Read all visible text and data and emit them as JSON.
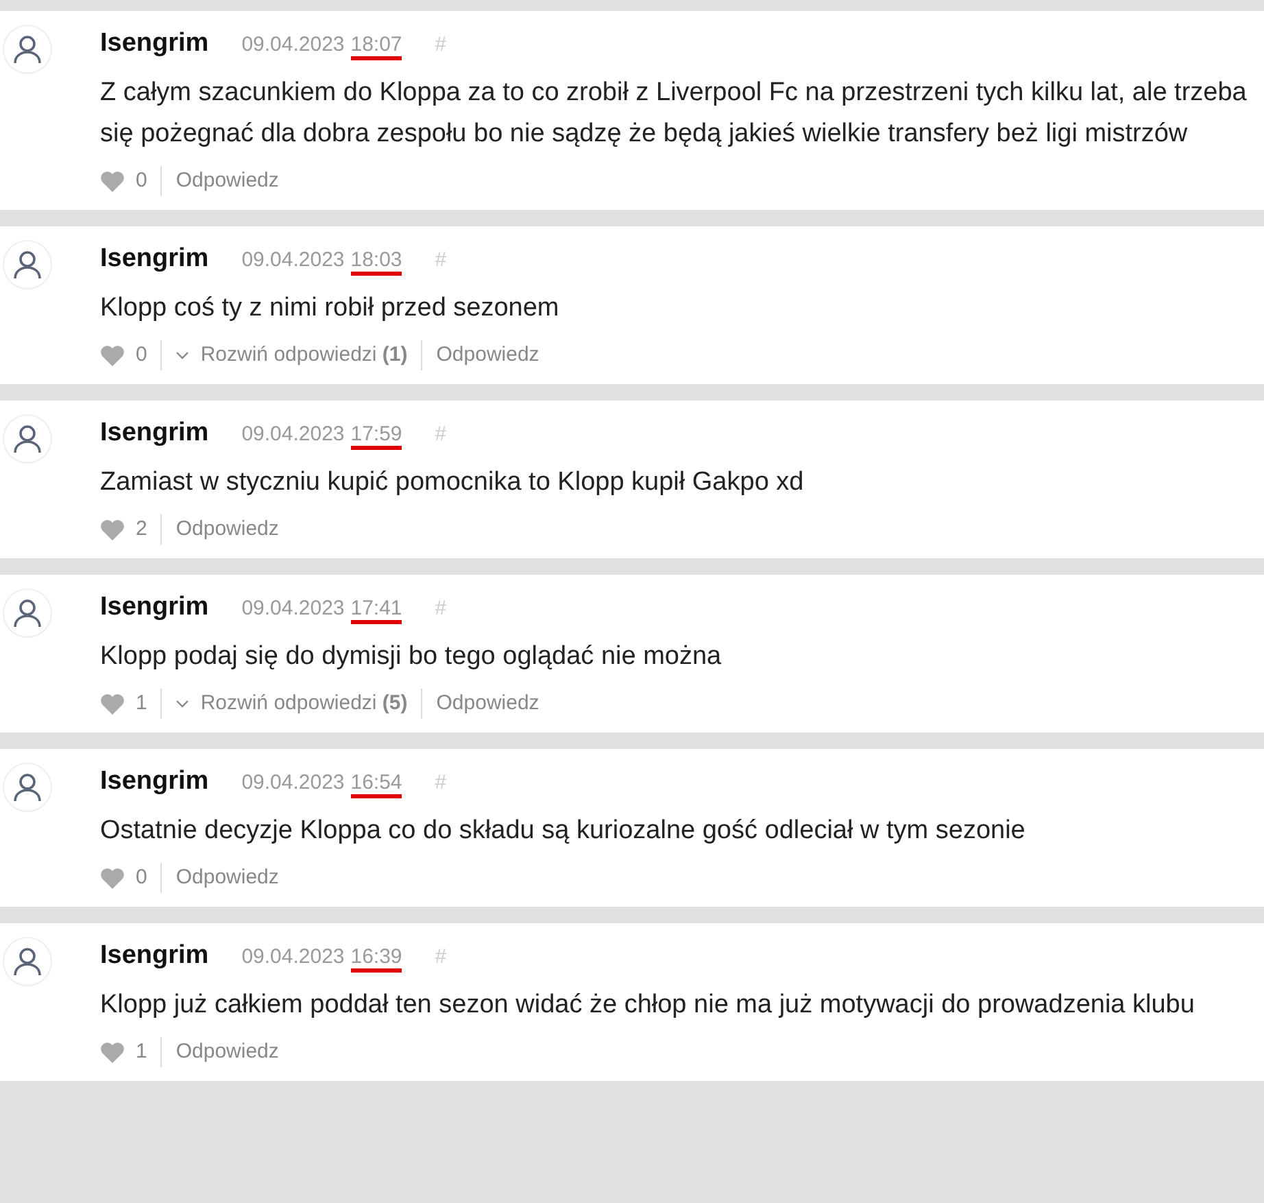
{
  "comments": [
    {
      "author": "Isengrim",
      "date": "09.04.2023",
      "time": "18:07",
      "time_marked": true,
      "hash": "#",
      "text": "Z całym szacunkiem do Kloppa za to co zrobił z Liverpool Fc na przestrzeni tych kilku lat, ale trzeba się pożegnać dla dobra zespołu bo nie sądzę że będą jakieś wielkie transfery beż ligi mistrzów",
      "likes": "0",
      "reply": "Odpowiedz"
    },
    {
      "author": "Isengrim",
      "date": "09.04.2023",
      "time": "18:03",
      "time_marked": true,
      "hash": "#",
      "text": "Klopp coś ty z nimi robił przed sezonem",
      "likes": "0",
      "expand": "Rozwiń odpowiedzi **(1)**",
      "reply": "Odpowiedz"
    },
    {
      "author": "Isengrim",
      "date": "09.04.2023",
      "time": "17:59",
      "time_marked": true,
      "hash": "#",
      "text": "Zamiast w styczniu kupić pomocnika to Klopp kupił Gakpo xd",
      "likes": "2",
      "reply": "Odpowiedz"
    },
    {
      "author": "Isengrim",
      "date": "09.04.2023",
      "time": "17:41",
      "time_marked": true,
      "hash": "#",
      "text": "Klopp podaj się do dymisji bo tego oglądać nie można",
      "likes": "1",
      "expand": "Rozwiń odpowiedzi **(5)**",
      "reply": "Odpowiedz"
    },
    {
      "author": "Isengrim",
      "date": "09.04.2023",
      "time": "16:54",
      "time_marked": true,
      "hash": "#",
      "text": "Ostatnie decyzje Kloppa co do składu są kuriozalne gość odleciał w tym sezonie",
      "likes": "0",
      "reply": "Odpowiedz"
    },
    {
      "author": "Isengrim",
      "date": "09.04.2023",
      "time": "16:39",
      "time_marked": true,
      "hash": "#",
      "text": "Klopp już całkiem poddał ten sezon widać że chłop nie ma już motywacji do prowadzenia klubu",
      "likes": "1",
      "reply": "Odpowiedz"
    }
  ]
}
